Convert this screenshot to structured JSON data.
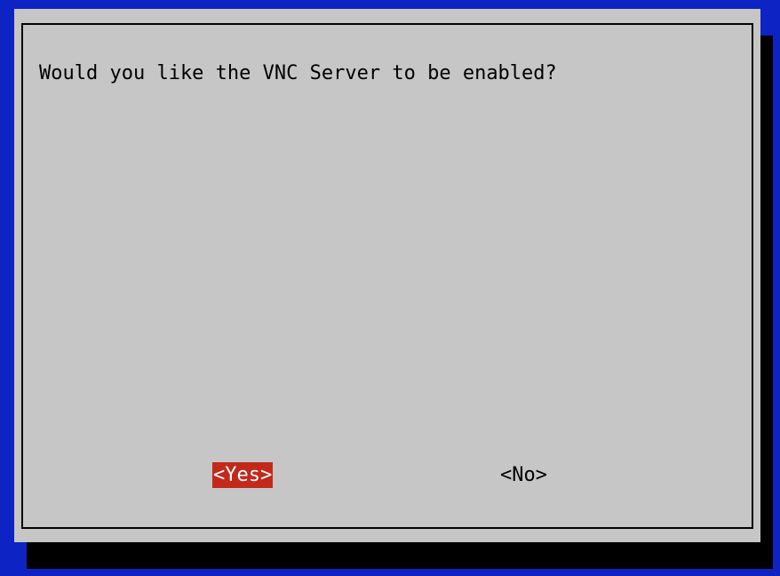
{
  "dialog": {
    "message": "Would you like the VNC Server to be enabled?",
    "buttons": {
      "yes_label": "<Yes>",
      "no_label": "<No>",
      "selected": "yes"
    }
  },
  "colors": {
    "background": "#0d23c4",
    "dialog": "#c6c6c6",
    "shadow": "#000000",
    "selected_button": "#c2291b"
  }
}
